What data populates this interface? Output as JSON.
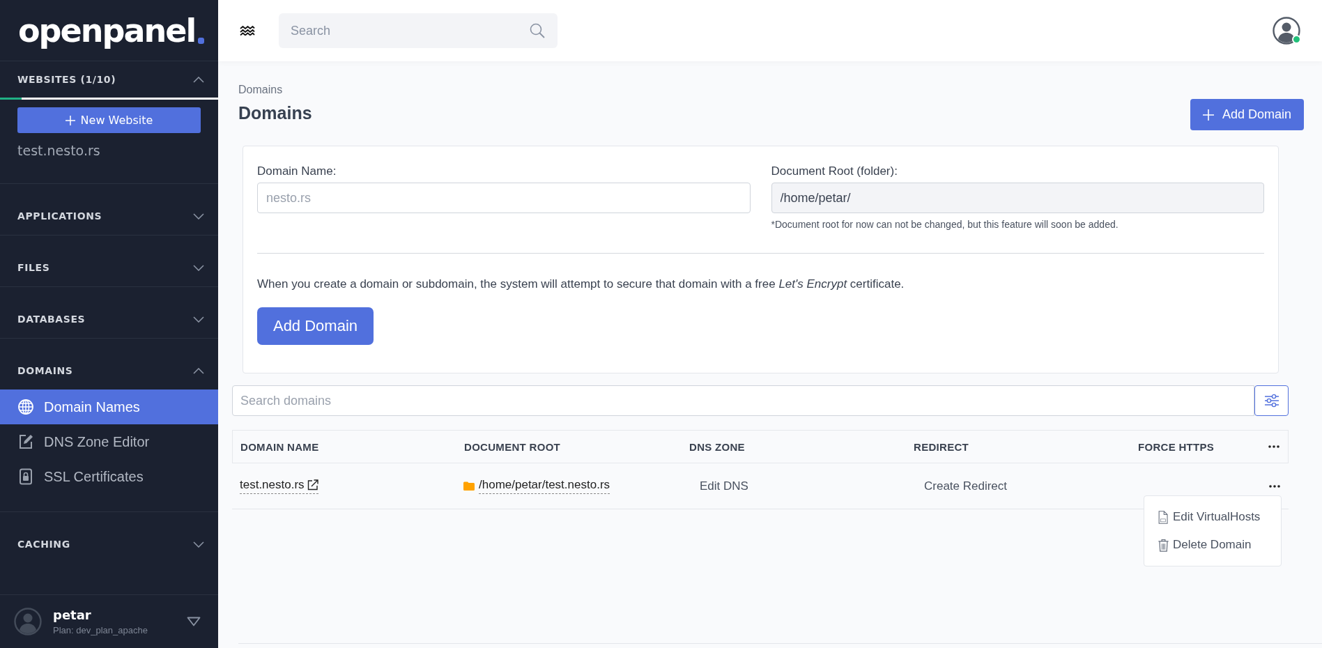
{
  "sidebar": {
    "logo": "openpanel",
    "websites": {
      "title": "WEBSITES (1/10)",
      "expanded": true,
      "level": 0.1,
      "new_button": "New Website",
      "sites": [
        "test.nesto.rs"
      ]
    },
    "sections": [
      {
        "title": "APPLICATIONS",
        "expanded": false
      },
      {
        "title": "FILES",
        "expanded": false
      },
      {
        "title": "DATABASES",
        "expanded": false
      },
      {
        "title": "DOMAINS",
        "expanded": true,
        "items": [
          {
            "label": "Domain Names",
            "kind": "globe",
            "selected": true
          },
          {
            "label": "DNS Zone Editor",
            "kind": "edit",
            "selected": false
          },
          {
            "label": "SSL Certificates",
            "kind": "lock",
            "selected": false
          }
        ]
      },
      {
        "title": "CACHING",
        "expanded": false
      }
    ],
    "user": {
      "name": "petar",
      "plan": "Plan: dev_plan_apache"
    }
  },
  "header": {
    "search": {
      "placeholder": "Search"
    },
    "user_online": true
  },
  "page": {
    "breadcrumb": "Domains",
    "title": "Domains",
    "add_button": "Add Domain"
  },
  "form": {
    "domain_label": "Domain Name:",
    "domain_placeholder": "nesto.rs",
    "root_label": "Document Root (folder):",
    "root_value": "/home/petar/",
    "root_disabled": true,
    "note": "*Document root for now can not be changed, but this feature will soon be added.",
    "info": "When you create a domain or subdomain, the system will attempt to secure that domain with a free *Let's Encrypt* certificate.",
    "submit": "Add Domain"
  },
  "table": {
    "search": {
      "placeholder": "Search domains"
    },
    "columns": [
      "DOMAIN NAME",
      "DOCUMENT ROOT",
      "DNS ZONE",
      "REDIRECT",
      "FORCE HTTPS"
    ],
    "rows": [
      {
        "domain": "test.nesto.rs",
        "document_root": "/home/petar/test.nesto.rs",
        "dns_zone": "Edit DNS",
        "redirect": "Create Redirect"
      }
    ],
    "row_menu": {
      "open": true,
      "items": [
        {
          "label": "Edit VirtualHosts",
          "kind": "file"
        },
        {
          "label": "Delete Domain",
          "kind": "trash"
        }
      ]
    }
  }
}
